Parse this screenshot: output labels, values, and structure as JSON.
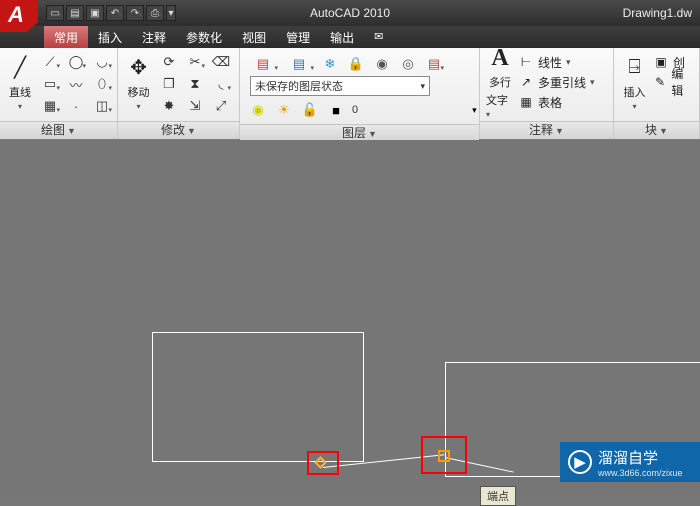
{
  "titlebar": {
    "app_name": "AutoCAD 2010",
    "doc_name": "Drawing1.dw"
  },
  "tabs": {
    "t0": "常用",
    "t1": "插入",
    "t2": "注释",
    "t3": "参数化",
    "t4": "视图",
    "t5": "管理",
    "t6": "输出"
  },
  "panels": {
    "draw": {
      "title": "绘图",
      "line_label": "直线"
    },
    "modify": {
      "title": "修改",
      "move_label": "移动"
    },
    "layer": {
      "title": "图层",
      "state_text": "未保存的图层状态"
    },
    "annotate": {
      "title": "注释",
      "mtext_top": "多行",
      "mtext_bot": "文字",
      "linetype": "线性",
      "multileader": "多重引线",
      "table": "表格"
    },
    "block": {
      "title": "块",
      "insert": "插入",
      "create": "创",
      "edit": "编辑"
    }
  },
  "watermark": {
    "brand": "溜溜自学",
    "url": "www.3d66.com/zixue"
  }
}
